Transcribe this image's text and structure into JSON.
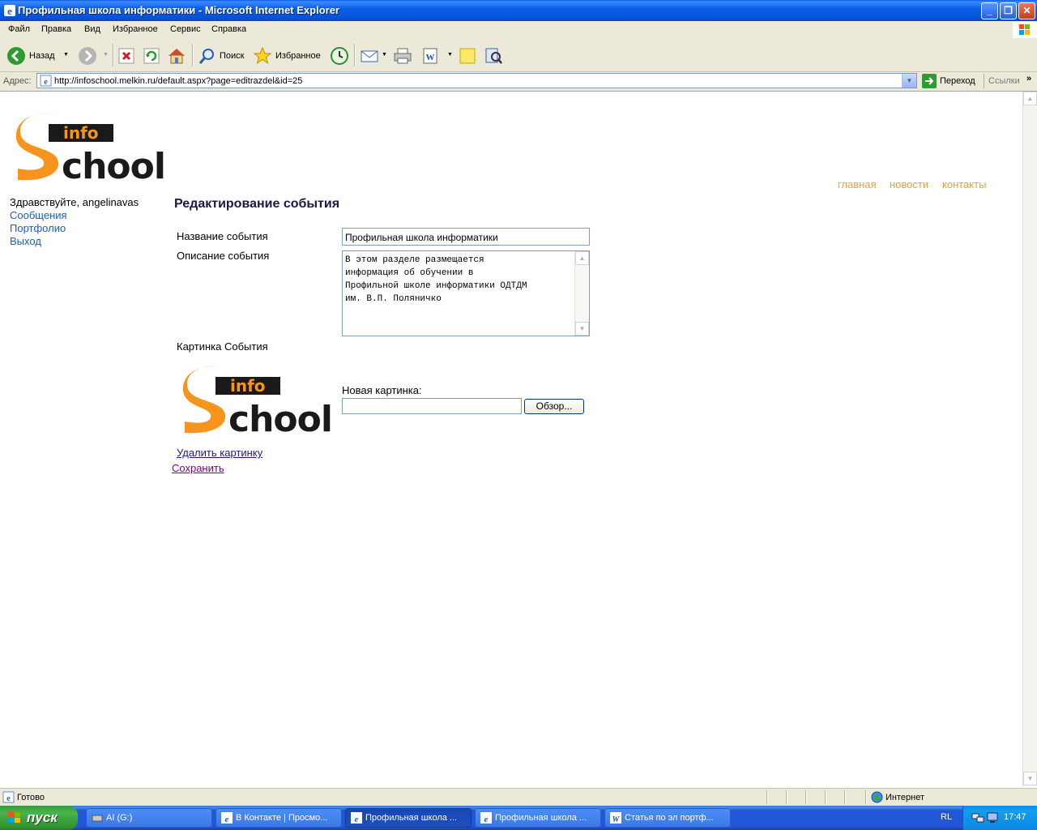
{
  "window": {
    "title": "Профильная школа информатики - Microsoft Internet Explorer"
  },
  "menu": [
    "Файл",
    "Правка",
    "Вид",
    "Избранное",
    "Сервис",
    "Справка"
  ],
  "toolbar": {
    "back_label": "Назад",
    "search_label": "Поиск",
    "favorites_label": "Избранное"
  },
  "address": {
    "label": "Адрес:",
    "url": "http://infoschool.melkin.ru/default.aspx?page=editrazdel&id=25",
    "go_label": "Переход",
    "links_label": "Ссылки"
  },
  "site": {
    "logo_text_small": "info",
    "logo_text_big": "chool",
    "nav": [
      "главная",
      "новости",
      "контакты"
    ],
    "greeting": "Здравствуйте, angelinavas",
    "side_links": [
      "Сообщения",
      "Портфолио",
      "Выход"
    ]
  },
  "form": {
    "heading": "Редактирование события",
    "name_label": "Название события",
    "name_value": "Профильная школа информатики",
    "desc_label": "Описание события",
    "desc_value": "В этом разделе размещается\nинформация об обучении в\nПрофильной школе информатики ОДТДМ\nим. В.П. Поляничко",
    "picture_label": "Картинка События",
    "new_picture_label": "Новая картинка:",
    "browse_label": "Обзор...",
    "delete_link": "Удалить картинку",
    "save_link": "Сохранить"
  },
  "status": {
    "text": "Готово",
    "zone": "Интернет"
  },
  "taskbar": {
    "start_label": "пуск",
    "tasks": [
      "AI (G:)",
      "В Контакте | Просмо...",
      "Профильная школа ...",
      "Профильная школа ...",
      "Статья по эл портф..."
    ],
    "lang": "RL",
    "time": "17:47"
  },
  "colors": {
    "logo_orange": "#f7941d",
    "nav_orange": "#e4a040",
    "link_blue": "#1f5bc6",
    "visited_purple": "#800080"
  }
}
